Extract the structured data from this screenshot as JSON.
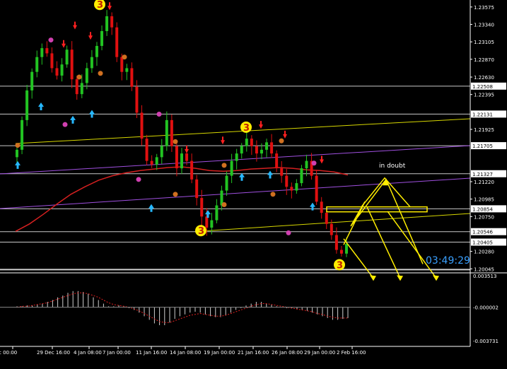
{
  "colors": {
    "background": "#000000",
    "bull_candle": "#22c322",
    "bear_candle": "#e01010",
    "text": "#ffffff",
    "moving_average": "#d42020",
    "yellow_lines": "#d7d700",
    "purple_lines": "#a050e0",
    "horizontal_levels": "#c8c8c8",
    "countdown": "#3aa0ff",
    "up_arrow": "#26b8ff",
    "down_arrow": "#ff2020",
    "fractal_magenta": "#d040b0",
    "fractal_orange": "#d07020",
    "wave_label": "#ffee00",
    "histogram": "#d0d0d0",
    "signal_line": "#e02020"
  },
  "chart_data": [
    {
      "type": "candlestick",
      "title": "",
      "ylim": [
        1.2,
        1.2365
      ],
      "y_tick_labels": [
        "1.23575",
        "1.23340",
        "1.23105",
        "1.22870",
        "1.22630",
        "1.22508",
        "1.22395",
        "1.22131",
        "1.21925",
        "1.21705",
        "1.21327",
        "1.21220",
        "1.20985",
        "1.20854",
        "1.20750",
        "1.20546",
        "1.20405",
        "1.20280",
        "1.20045"
      ],
      "x_tick_labels": [
        "c 00:00",
        "29 Dec 16:00",
        "4 Jan 08:00",
        "7 Jan 00:00",
        "11 Jan 16:00",
        "14 Jan 08:00",
        "19 Jan 00:00",
        "21 Jan 16:00",
        "26 Jan 08:00",
        "29 Jan 00:00",
        "2 Feb 16:00"
      ],
      "horizontal_levels": [
        1.22508,
        1.22131,
        1.21705,
        1.21327,
        1.20854,
        1.20546,
        1.20405
      ],
      "current_price_level": 1.20035,
      "annotation_text": "in doubt",
      "countdown_text": "03:49:29",
      "wave_labels": [
        "3",
        "3",
        "3",
        "3"
      ],
      "price_path_close": [
        1.2165,
        1.2205,
        1.2245,
        1.227,
        1.229,
        1.2302,
        1.2295,
        1.2275,
        1.2265,
        1.228,
        1.23,
        1.226,
        1.224,
        1.2255,
        1.2275,
        1.229,
        1.2305,
        1.2325,
        1.2345,
        1.233,
        1.229,
        1.227,
        1.2275,
        1.225,
        1.2215,
        1.218,
        1.215,
        1.2145,
        1.2155,
        1.217,
        1.2205,
        1.217,
        1.214,
        1.216,
        1.215,
        1.2125,
        1.21,
        1.2075,
        1.206,
        1.207,
        1.209,
        1.211,
        1.213,
        1.215,
        1.216,
        1.217,
        1.218,
        1.217,
        1.216,
        1.2165,
        1.2175,
        1.216,
        1.214,
        1.213,
        1.2115,
        1.211,
        1.212,
        1.214,
        1.215,
        1.213,
        1.2095,
        1.208,
        1.2065,
        1.205,
        1.203,
        1.2025,
        1.2038
      ],
      "moving_average_path": [
        1.2055,
        1.2065,
        1.2078,
        1.2092,
        1.2105,
        1.2115,
        1.2124,
        1.213,
        1.2134,
        1.2137,
        1.2139,
        1.2141,
        1.2142,
        1.214,
        1.2137,
        1.2136,
        1.2137,
        1.2139,
        1.214,
        1.2141,
        1.214,
        1.2138,
        1.2137,
        1.2135,
        1.2131
      ],
      "projected_up": [
        [
          1.2037,
          1.209
        ],
        [
          1.209,
          1.206
        ],
        [
          1.206,
          1.213
        ],
        [
          1.213,
          1.199
        ]
      ],
      "projected_down": [
        1.1992,
        1.1998,
        1.2002
      ]
    },
    {
      "type": "histogram",
      "ylim": [
        -0.003731,
        0.003513
      ],
      "y_tick_labels": [
        "0.003513",
        "-0.000002",
        "-0.003731"
      ],
      "values": [
        0.0001,
        0.0001,
        0.0002,
        0.0002,
        0.0003,
        0.0004,
        0.0006,
        0.0008,
        0.0011,
        0.0013,
        0.0016,
        0.0018,
        0.0018,
        0.0017,
        0.0015,
        0.0011,
        0.0008,
        0.0004,
        0.0001,
        0.0001,
        0.0002,
        0.0001,
        -0.0001,
        -0.0003,
        -0.0006,
        -0.001,
        -0.0014,
        -0.0018,
        -0.002,
        -0.002,
        -0.0017,
        -0.0013,
        -0.001,
        -0.0008,
        -0.0006,
        -0.0005,
        -0.0006,
        -0.0008,
        -0.001,
        -0.0011,
        -0.0011,
        -0.0009,
        -0.0006,
        -0.0003,
        -0.0001,
        0.0002,
        0.0004,
        0.0006,
        0.0006,
        0.0004,
        0.0003,
        0.0001,
        0.0,
        -0.0001,
        -0.0001,
        -0.0002,
        -0.0003,
        -0.0004,
        -0.0006,
        -0.0008,
        -0.001,
        -0.0012,
        -0.0014,
        -0.0014,
        -0.0013,
        -0.0012
      ],
      "signal_line": [
        0.0,
        0.0001,
        0.0001,
        0.0002,
        0.0003,
        0.0004,
        0.0005,
        0.0007,
        0.0009,
        0.0011,
        0.0013,
        0.0015,
        0.0016,
        0.0016,
        0.0015,
        0.0013,
        0.0011,
        0.0008,
        0.0005,
        0.0003,
        0.0002,
        0.0001,
        0.0,
        -0.0002,
        -0.0004,
        -0.0007,
        -0.001,
        -0.0013,
        -0.0016,
        -0.0017,
        -0.0017,
        -0.0015,
        -0.0013,
        -0.0011,
        -0.0009,
        -0.0008,
        -0.0007,
        -0.0008,
        -0.0009,
        -0.001,
        -0.001,
        -0.0009,
        -0.0007,
        -0.0005,
        -0.0003,
        -0.0001,
        0.0001,
        0.0003,
        0.0004,
        0.0004,
        0.0003,
        0.0002,
        0.0001,
        0.0,
        -0.0001,
        -0.0002,
        -0.0003,
        -0.0004,
        -0.0005,
        -0.0007,
        -0.0008,
        -0.001,
        -0.0011,
        -0.0012,
        -0.0012,
        -0.0012
      ]
    }
  ]
}
